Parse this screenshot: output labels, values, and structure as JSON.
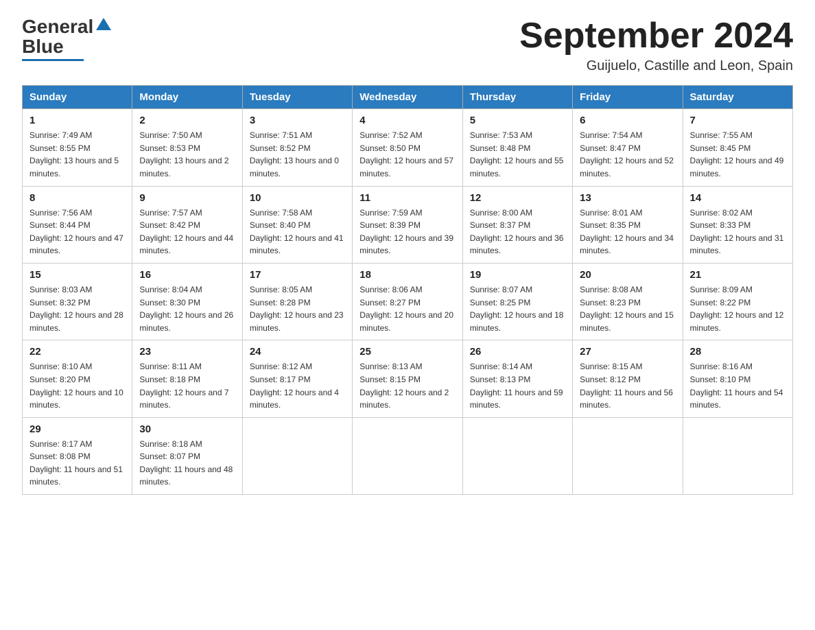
{
  "header": {
    "logo_general": "General",
    "logo_blue": "Blue",
    "month_title": "September 2024",
    "location": "Guijuelo, Castille and Leon, Spain"
  },
  "days_of_week": [
    "Sunday",
    "Monday",
    "Tuesday",
    "Wednesday",
    "Thursday",
    "Friday",
    "Saturday"
  ],
  "weeks": [
    [
      {
        "day": "1",
        "sunrise": "7:49 AM",
        "sunset": "8:55 PM",
        "daylight": "13 hours and 5 minutes."
      },
      {
        "day": "2",
        "sunrise": "7:50 AM",
        "sunset": "8:53 PM",
        "daylight": "13 hours and 2 minutes."
      },
      {
        "day": "3",
        "sunrise": "7:51 AM",
        "sunset": "8:52 PM",
        "daylight": "13 hours and 0 minutes."
      },
      {
        "day": "4",
        "sunrise": "7:52 AM",
        "sunset": "8:50 PM",
        "daylight": "12 hours and 57 minutes."
      },
      {
        "day": "5",
        "sunrise": "7:53 AM",
        "sunset": "8:48 PM",
        "daylight": "12 hours and 55 minutes."
      },
      {
        "day": "6",
        "sunrise": "7:54 AM",
        "sunset": "8:47 PM",
        "daylight": "12 hours and 52 minutes."
      },
      {
        "day": "7",
        "sunrise": "7:55 AM",
        "sunset": "8:45 PM",
        "daylight": "12 hours and 49 minutes."
      }
    ],
    [
      {
        "day": "8",
        "sunrise": "7:56 AM",
        "sunset": "8:44 PM",
        "daylight": "12 hours and 47 minutes."
      },
      {
        "day": "9",
        "sunrise": "7:57 AM",
        "sunset": "8:42 PM",
        "daylight": "12 hours and 44 minutes."
      },
      {
        "day": "10",
        "sunrise": "7:58 AM",
        "sunset": "8:40 PM",
        "daylight": "12 hours and 41 minutes."
      },
      {
        "day": "11",
        "sunrise": "7:59 AM",
        "sunset": "8:39 PM",
        "daylight": "12 hours and 39 minutes."
      },
      {
        "day": "12",
        "sunrise": "8:00 AM",
        "sunset": "8:37 PM",
        "daylight": "12 hours and 36 minutes."
      },
      {
        "day": "13",
        "sunrise": "8:01 AM",
        "sunset": "8:35 PM",
        "daylight": "12 hours and 34 minutes."
      },
      {
        "day": "14",
        "sunrise": "8:02 AM",
        "sunset": "8:33 PM",
        "daylight": "12 hours and 31 minutes."
      }
    ],
    [
      {
        "day": "15",
        "sunrise": "8:03 AM",
        "sunset": "8:32 PM",
        "daylight": "12 hours and 28 minutes."
      },
      {
        "day": "16",
        "sunrise": "8:04 AM",
        "sunset": "8:30 PM",
        "daylight": "12 hours and 26 minutes."
      },
      {
        "day": "17",
        "sunrise": "8:05 AM",
        "sunset": "8:28 PM",
        "daylight": "12 hours and 23 minutes."
      },
      {
        "day": "18",
        "sunrise": "8:06 AM",
        "sunset": "8:27 PM",
        "daylight": "12 hours and 20 minutes."
      },
      {
        "day": "19",
        "sunrise": "8:07 AM",
        "sunset": "8:25 PM",
        "daylight": "12 hours and 18 minutes."
      },
      {
        "day": "20",
        "sunrise": "8:08 AM",
        "sunset": "8:23 PM",
        "daylight": "12 hours and 15 minutes."
      },
      {
        "day": "21",
        "sunrise": "8:09 AM",
        "sunset": "8:22 PM",
        "daylight": "12 hours and 12 minutes."
      }
    ],
    [
      {
        "day": "22",
        "sunrise": "8:10 AM",
        "sunset": "8:20 PM",
        "daylight": "12 hours and 10 minutes."
      },
      {
        "day": "23",
        "sunrise": "8:11 AM",
        "sunset": "8:18 PM",
        "daylight": "12 hours and 7 minutes."
      },
      {
        "day": "24",
        "sunrise": "8:12 AM",
        "sunset": "8:17 PM",
        "daylight": "12 hours and 4 minutes."
      },
      {
        "day": "25",
        "sunrise": "8:13 AM",
        "sunset": "8:15 PM",
        "daylight": "12 hours and 2 minutes."
      },
      {
        "day": "26",
        "sunrise": "8:14 AM",
        "sunset": "8:13 PM",
        "daylight": "11 hours and 59 minutes."
      },
      {
        "day": "27",
        "sunrise": "8:15 AM",
        "sunset": "8:12 PM",
        "daylight": "11 hours and 56 minutes."
      },
      {
        "day": "28",
        "sunrise": "8:16 AM",
        "sunset": "8:10 PM",
        "daylight": "11 hours and 54 minutes."
      }
    ],
    [
      {
        "day": "29",
        "sunrise": "8:17 AM",
        "sunset": "8:08 PM",
        "daylight": "11 hours and 51 minutes."
      },
      {
        "day": "30",
        "sunrise": "8:18 AM",
        "sunset": "8:07 PM",
        "daylight": "11 hours and 48 minutes."
      },
      null,
      null,
      null,
      null,
      null
    ]
  ]
}
